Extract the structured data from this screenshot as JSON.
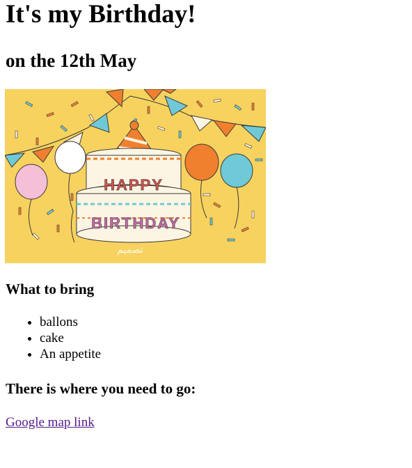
{
  "page": {
    "title": "It's my Birthday!",
    "subtitle": "on the 12th May"
  },
  "image": {
    "alt": "Happy Birthday cake illustration",
    "cake_text_top": "HAPPY",
    "cake_text_bottom": "BIRTHDAY",
    "signature": "تصميم",
    "colors": {
      "background": "#f7d25e",
      "orange": "#f0802e",
      "teal": "#6fc9d6",
      "pink": "#f5bfd8",
      "white": "#ffffff",
      "cream": "#fdf5e3",
      "outline": "#3a3a3a"
    }
  },
  "bring": {
    "heading": "What to bring",
    "items": [
      "ballons",
      "cake",
      "An appetite"
    ]
  },
  "go": {
    "heading": "There is where you need to go:",
    "link_text": "Google map link"
  }
}
